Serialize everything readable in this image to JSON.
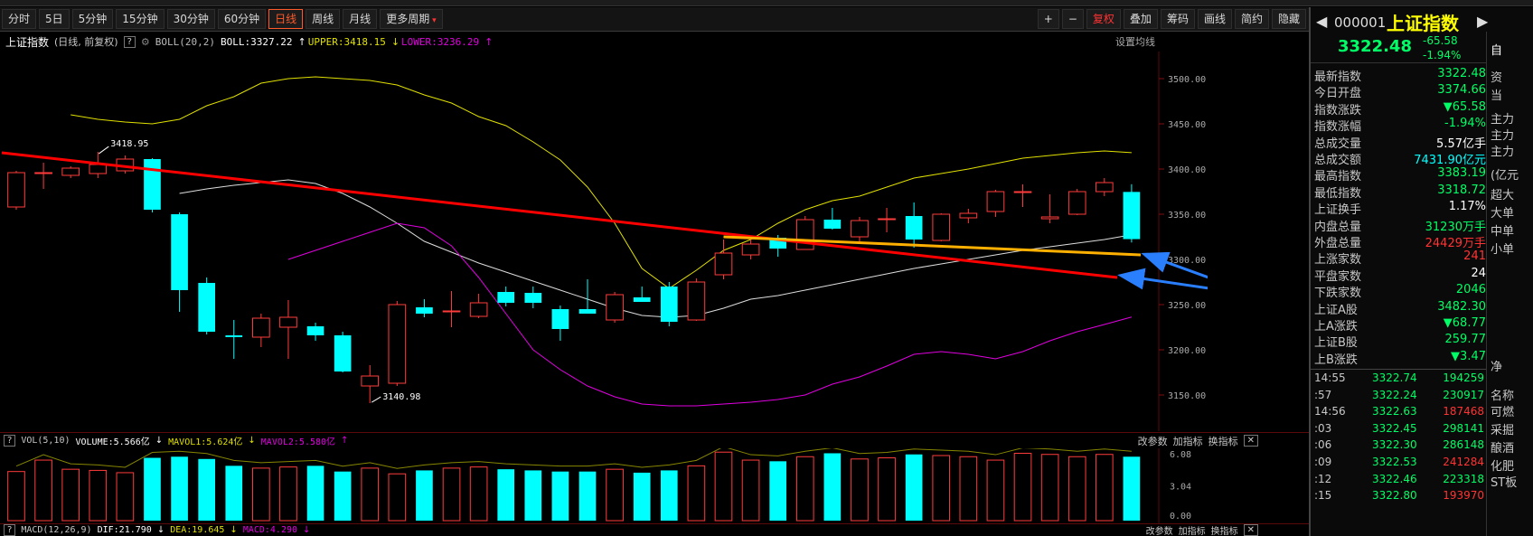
{
  "toolbar": {
    "periods": [
      "分时",
      "5日",
      "5分钟",
      "15分钟",
      "30分钟",
      "60分钟",
      "日线",
      "周线",
      "月线",
      "更多周期"
    ],
    "active_period": "日线",
    "right_buttons": [
      "+",
      "−",
      "复权",
      "叠加",
      "筹码",
      "画线",
      "简约",
      "隐藏"
    ]
  },
  "info": {
    "name": "上证指数",
    "mode": "(日线, 前复权)",
    "indicator": "BOLL(20,2)",
    "boll": "BOLL:3327.22",
    "upper": "UPPER:3418.15",
    "lower": "LOWER:3236.29",
    "setting": "设置均线"
  },
  "colors": {
    "up": "#ff3b3b",
    "down": "#00ffff",
    "mid": "#dddddd",
    "upper": "#e0e000",
    "lower": "#e000e0",
    "trend_red": "#ff0000",
    "trend_yellow": "#ffb000",
    "arrow": "#2a7fff"
  },
  "chart_data": {
    "type": "candlestick",
    "ylim": [
      3110,
      3530
    ],
    "y_ticks": [
      3500,
      3450,
      3400,
      3350,
      3300,
      3250,
      3200,
      3150
    ],
    "y_tick_labels": [
      "3500.00",
      "3450.00",
      "3400.00",
      "3350.00",
      "3300.00",
      "3250.00",
      "3200.00",
      "3150.00"
    ],
    "candles": [
      {
        "o": 3358,
        "c": 3396,
        "h": 3398,
        "l": 3355
      },
      {
        "o": 3396,
        "c": 3396,
        "h": 3407,
        "l": 3378
      },
      {
        "o": 3393,
        "c": 3401,
        "h": 3403,
        "l": 3390
      },
      {
        "o": 3395,
        "c": 3405,
        "h": 3418.95,
        "l": 3390
      },
      {
        "o": 3398,
        "c": 3411,
        "h": 3415,
        "l": 3395
      },
      {
        "o": 3411,
        "c": 3355,
        "h": 3412,
        "l": 3352
      },
      {
        "o": 3350,
        "c": 3266,
        "h": 3352,
        "l": 3242
      },
      {
        "o": 3274,
        "c": 3220,
        "h": 3280,
        "l": 3217
      },
      {
        "o": 3216,
        "c": 3214,
        "h": 3233,
        "l": 3190
      },
      {
        "o": 3214,
        "c": 3235,
        "h": 3240,
        "l": 3203
      },
      {
        "o": 3225,
        "c": 3236,
        "h": 3255,
        "l": 3190
      },
      {
        "o": 3226,
        "c": 3216,
        "h": 3230,
        "l": 3210
      },
      {
        "o": 3216,
        "c": 3176,
        "h": 3220,
        "l": 3175
      },
      {
        "o": 3160,
        "c": 3171,
        "h": 3183,
        "l": 3140.98
      },
      {
        "o": 3163,
        "c": 3250,
        "h": 3254,
        "l": 3160
      },
      {
        "o": 3247,
        "c": 3240,
        "h": 3256,
        "l": 3236
      },
      {
        "o": 3243,
        "c": 3243,
        "h": 3265,
        "l": 3225
      },
      {
        "o": 3237,
        "c": 3252,
        "h": 3262,
        "l": 3235
      },
      {
        "o": 3264,
        "c": 3252,
        "h": 3270,
        "l": 3248
      },
      {
        "o": 3263,
        "c": 3252,
        "h": 3270,
        "l": 3246
      },
      {
        "o": 3245,
        "c": 3223,
        "h": 3249,
        "l": 3210
      },
      {
        "o": 3245,
        "c": 3240,
        "h": 3278,
        "l": 3240
      },
      {
        "o": 3233,
        "c": 3261,
        "h": 3264,
        "l": 3230
      },
      {
        "o": 3258,
        "c": 3253,
        "h": 3270,
        "l": 3253
      },
      {
        "o": 3270,
        "c": 3231,
        "h": 3275,
        "l": 3226
      },
      {
        "o": 3233,
        "c": 3275,
        "h": 3279,
        "l": 3232
      },
      {
        "o": 3283,
        "c": 3307,
        "h": 3322,
        "l": 3278
      },
      {
        "o": 3305,
        "c": 3317,
        "h": 3323,
        "l": 3300
      },
      {
        "o": 3324,
        "c": 3312,
        "h": 3327,
        "l": 3303
      },
      {
        "o": 3311,
        "c": 3344,
        "h": 3348,
        "l": 3311
      },
      {
        "o": 3344,
        "c": 3334,
        "h": 3357,
        "l": 3333
      },
      {
        "o": 3325,
        "c": 3343,
        "h": 3347,
        "l": 3320
      },
      {
        "o": 3345,
        "c": 3345,
        "h": 3357,
        "l": 3330
      },
      {
        "o": 3348,
        "c": 3322,
        "h": 3363,
        "l": 3313
      },
      {
        "o": 3321,
        "c": 3350,
        "h": 3351,
        "l": 3320
      },
      {
        "o": 3346,
        "c": 3351,
        "h": 3356,
        "l": 3340
      },
      {
        "o": 3353,
        "c": 3375,
        "h": 3377,
        "l": 3347
      },
      {
        "o": 3375,
        "c": 3375,
        "h": 3383,
        "l": 3358
      },
      {
        "o": 3345,
        "c": 3347,
        "h": 3372,
        "l": 3340
      },
      {
        "o": 3350,
        "c": 3375,
        "h": 3378,
        "l": 3349
      },
      {
        "o": 3375,
        "c": 3385,
        "h": 3390,
        "l": 3370
      },
      {
        "o": 3374.66,
        "c": 3322.48,
        "h": 3383.19,
        "l": 3318.72
      }
    ],
    "upper": [
      3460,
      3455,
      3452,
      3450,
      3455,
      3470,
      3480,
      3495,
      3500,
      3502,
      3500,
      3498,
      3493,
      3482,
      3473,
      3458,
      3448,
      3430,
      3410,
      3380,
      3340,
      3290,
      3268,
      3288,
      3310,
      3322,
      3340,
      3355,
      3365,
      3370,
      3380,
      3390,
      3395,
      3400,
      3406,
      3412,
      3415,
      3418,
      3420,
      3418.15
    ],
    "mid": [
      3373,
      3378,
      3382,
      3385,
      3388,
      3384,
      3373,
      3358,
      3340,
      3320,
      3308,
      3296,
      3286,
      3276,
      3266,
      3256,
      3246,
      3238,
      3236,
      3238,
      3246,
      3256,
      3260,
      3266,
      3272,
      3278,
      3284,
      3290,
      3295,
      3300,
      3305,
      3310,
      3314,
      3318,
      3322,
      3327.22
    ],
    "lower": [
      3300,
      3310,
      3320,
      3330,
      3340,
      3335,
      3315,
      3280,
      3240,
      3200,
      3178,
      3160,
      3148,
      3140,
      3138,
      3138,
      3140,
      3142,
      3145,
      3150,
      3162,
      3170,
      3182,
      3195,
      3198,
      3195,
      3190,
      3198,
      3210,
      3220,
      3228,
      3236.29
    ],
    "annotations": {
      "high": "3418.95",
      "low": "3140.98"
    },
    "trend_red": {
      "from": 3418,
      "to": 3280
    },
    "trend_yellow": {
      "from": 3325,
      "to": 3305
    }
  },
  "volume": {
    "label": "VOL(5,10)",
    "volume": "VOLUME:5.566亿",
    "mavol1": "MAVOL1:5.624亿",
    "mavol2": "MAVOL2:5.580亿",
    "actions": [
      "改参数",
      "加指标",
      "换指标"
    ],
    "y_ticks": [
      "6.08",
      "3.04",
      "0.00"
    ],
    "ymax": 6.08,
    "values": [
      4.3,
      5.3,
      4.5,
      4.4,
      4.2,
      5.5,
      5.6,
      5.4,
      4.8,
      4.6,
      4.7,
      4.8,
      4.3,
      4.6,
      4.1,
      4.4,
      4.6,
      4.7,
      4.5,
      4.4,
      4.3,
      4.3,
      4.5,
      4.2,
      4.4,
      4.8,
      6.0,
      5.3,
      5.2,
      5.6,
      5.9,
      5.4,
      5.5,
      5.8,
      5.7,
      5.6,
      5.3,
      5.9,
      5.8,
      5.6,
      5.8,
      5.6
    ]
  },
  "macd": {
    "label": "MACD(12,26,9)",
    "dif": "DIF:21.790",
    "dea": "DEA:19.645",
    "macd": "MACD:4.290",
    "actions": [
      "改参数",
      "加指标",
      "换指标"
    ]
  },
  "quote": {
    "code": "000001",
    "name": "上证指数",
    "price": "3322.48",
    "change": "-65.58",
    "pct": "-1.94%",
    "side_btn": "自"
  },
  "stats": [
    {
      "k": "最新指数",
      "v": "3322.48",
      "c": "#00ff66"
    },
    {
      "k": "今日开盘",
      "v": "3374.66",
      "c": "#00ff66"
    },
    {
      "k": "指数涨跌",
      "v": "▼65.58",
      "c": "#00ff66"
    },
    {
      "k": "指数涨幅",
      "v": "-1.94%",
      "c": "#00ff66"
    },
    {
      "k": "总成交量",
      "v": "5.57亿手",
      "c": "#ffffff"
    },
    {
      "k": "总成交额",
      "v": "7431.90亿元",
      "c": "#00ffff"
    },
    {
      "k": "最高指数",
      "v": "3383.19",
      "c": "#00ff66"
    },
    {
      "k": "最低指数",
      "v": "3318.72",
      "c": "#00ff66"
    },
    {
      "k": "上证换手",
      "v": "1.17%",
      "c": "#ffffff"
    },
    {
      "k": "内盘总量",
      "v": "31230万手",
      "c": "#00ff66"
    },
    {
      "k": "外盘总量",
      "v": "24429万手",
      "c": "#ff3333"
    },
    {
      "k": "上涨家数",
      "v": "241",
      "c": "#ff3333"
    },
    {
      "k": "平盘家数",
      "v": "24",
      "c": "#ffffff"
    },
    {
      "k": "下跌家数",
      "v": "2046",
      "c": "#00ff66"
    },
    {
      "k": "上证A股",
      "v": "3482.30",
      "c": "#00ff66"
    },
    {
      "k": "上A涨跌",
      "v": "▼68.77",
      "c": "#00ff66"
    },
    {
      "k": "上证B股",
      "v": "259.77",
      "c": "#00ff66"
    },
    {
      "k": "上B涨跌",
      "v": "▼3.47",
      "c": "#00ff66"
    }
  ],
  "ticks": [
    {
      "t": "14:55",
      "p": "3322.74",
      "v": "194259",
      "vc": "#00ff66"
    },
    {
      "t": ":57",
      "p": "3322.24",
      "v": "230917",
      "vc": "#00ff66"
    },
    {
      "t": "14:56",
      "p": "3322.63",
      "v": "187468",
      "vc": "#ff3333"
    },
    {
      "t": ":03",
      "p": "3322.45",
      "v": "298141",
      "vc": "#00ff66"
    },
    {
      "t": ":06",
      "p": "3322.30",
      "v": "286148",
      "vc": "#00ff66"
    },
    {
      "t": ":09",
      "p": "3322.53",
      "v": "241284",
      "vc": "#ff3333"
    },
    {
      "t": ":12",
      "p": "3322.46",
      "v": "223318",
      "vc": "#00ff66"
    },
    {
      "t": ":15",
      "p": "3322.80",
      "v": "193970",
      "vc": "#ff3333"
    }
  ],
  "far_right": [
    "资",
    "当",
    "主力",
    "主力",
    "主力",
    "(亿元",
    "超大",
    "大单",
    "中单",
    "小单",
    "净",
    "名称",
    "可燃",
    "采掘",
    "酿酒",
    "化肥",
    "ST板"
  ]
}
